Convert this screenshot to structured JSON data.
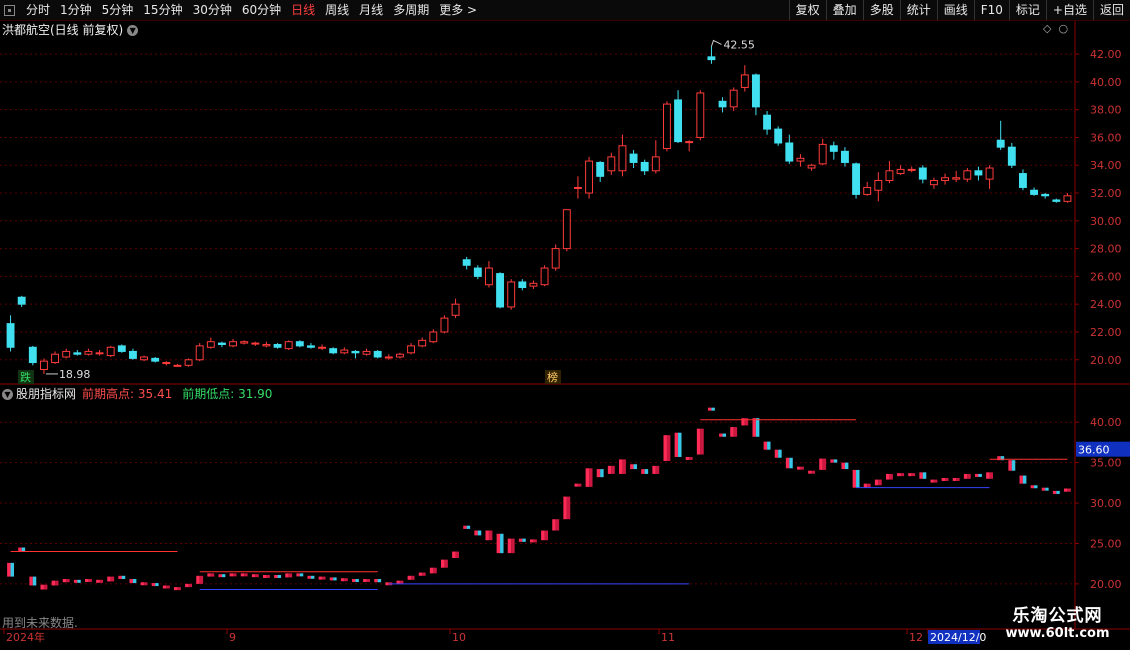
{
  "toolbar": {
    "left": [
      "分时",
      "1分钟",
      "5分钟",
      "15分钟",
      "30分钟",
      "60分钟",
      "日线",
      "周线",
      "月线",
      "多周期",
      "更多 >"
    ],
    "active_index": 6,
    "right": [
      "复权",
      "叠加",
      "多股",
      "统计",
      "画线",
      "F10",
      "标记",
      "+自选",
      "返回"
    ]
  },
  "stock_title": "洪都航空(日线 前复权)",
  "indicator": {
    "name": "股朋指标网",
    "high_label": "前期高点: 35.41",
    "low_label": "前期低点: 31.90",
    "current_value": "36.60"
  },
  "price_axis": [
    "42.00",
    "40.00",
    "38.00",
    "36.00",
    "34.00",
    "32.00",
    "30.00",
    "28.00",
    "26.00",
    "24.00",
    "22.00",
    "20.00"
  ],
  "ind_axis": [
    "40.00",
    "35.00",
    "30.00",
    "25.00",
    "20.00"
  ],
  "annotations": {
    "high": "42.55",
    "low": "18.98",
    "tag_die": "跌",
    "tag_bang": "榜"
  },
  "date_labels": [
    "2024年",
    "9",
    "10",
    "11",
    "12",
    "2024/12/0"
  ],
  "footer_note": "用到未来数据.",
  "watermark": {
    "name": "乐淘公式网",
    "url": "www.60lt.com"
  },
  "colors": {
    "up": "#ff3b3b",
    "down": "#40e0f0",
    "grid": "#5a0000",
    "axis_text": "#cc3333"
  },
  "chart_data": {
    "type": "candlestick",
    "candles": [
      [
        22.6,
        20.9,
        23.2,
        20.6
      ],
      [
        24.5,
        24.0,
        24.6,
        23.8
      ],
      [
        20.9,
        19.8,
        21.0,
        19.6
      ],
      [
        19.3,
        19.9,
        20.1,
        18.98
      ],
      [
        19.8,
        20.4,
        20.6,
        19.7
      ],
      [
        20.2,
        20.6,
        20.8,
        20.1
      ],
      [
        20.5,
        20.4,
        20.7,
        20.3
      ],
      [
        20.4,
        20.6,
        20.8,
        20.3
      ],
      [
        20.5,
        20.5,
        20.7,
        20.3
      ],
      [
        20.3,
        20.9,
        21.0,
        20.2
      ],
      [
        21.0,
        20.6,
        21.1,
        20.5
      ],
      [
        20.6,
        20.1,
        20.8,
        20.0
      ],
      [
        20.0,
        20.2,
        20.3,
        19.9
      ],
      [
        20.1,
        19.9,
        20.2,
        19.8
      ],
      [
        19.8,
        19.8,
        19.9,
        19.6
      ],
      [
        19.6,
        19.6,
        19.7,
        19.5
      ],
      [
        19.6,
        20.0,
        20.1,
        19.5
      ],
      [
        20.0,
        21.0,
        21.2,
        19.9
      ],
      [
        20.9,
        21.3,
        21.6,
        20.8
      ],
      [
        21.2,
        21.1,
        21.3,
        20.9
      ],
      [
        21.0,
        21.3,
        21.5,
        20.9
      ],
      [
        21.2,
        21.3,
        21.4,
        21.1
      ],
      [
        21.2,
        21.2,
        21.3,
        21.0
      ],
      [
        21.0,
        21.1,
        21.3,
        20.9
      ],
      [
        21.1,
        20.9,
        21.2,
        20.8
      ],
      [
        20.8,
        21.3,
        21.4,
        20.7
      ],
      [
        21.3,
        21.0,
        21.4,
        20.9
      ],
      [
        21.0,
        20.9,
        21.2,
        20.8
      ],
      [
        20.9,
        20.9,
        21.1,
        20.7
      ],
      [
        20.8,
        20.5,
        20.9,
        20.4
      ],
      [
        20.5,
        20.7,
        20.9,
        20.4
      ],
      [
        20.6,
        20.5,
        20.7,
        20.1
      ],
      [
        20.4,
        20.6,
        20.8,
        20.3
      ],
      [
        20.6,
        20.2,
        20.7,
        20.1
      ],
      [
        20.2,
        20.2,
        20.4,
        20.0
      ],
      [
        20.2,
        20.4,
        20.5,
        20.1
      ],
      [
        20.5,
        21.0,
        21.2,
        20.4
      ],
      [
        21.0,
        21.4,
        21.6,
        20.9
      ],
      [
        21.3,
        22.0,
        22.2,
        21.2
      ],
      [
        22.0,
        23.0,
        23.2,
        21.9
      ],
      [
        23.2,
        24.0,
        24.4,
        23.0
      ],
      [
        27.2,
        26.8,
        27.4,
        26.5
      ],
      [
        26.6,
        26.0,
        26.8,
        25.8
      ],
      [
        25.4,
        26.6,
        27.1,
        25.2
      ],
      [
        26.2,
        23.8,
        26.3,
        23.7
      ],
      [
        23.8,
        25.6,
        25.8,
        23.6
      ],
      [
        25.6,
        25.2,
        25.8,
        25.0
      ],
      [
        25.3,
        25.5,
        25.7,
        25.1
      ],
      [
        25.4,
        26.6,
        26.8,
        25.3
      ],
      [
        26.6,
        28.0,
        28.3,
        26.4
      ],
      [
        28.0,
        30.8,
        30.8,
        27.8
      ],
      [
        32.4,
        32.4,
        33.2,
        31.6
      ],
      [
        32.0,
        34.3,
        34.6,
        31.6
      ],
      [
        34.2,
        33.2,
        34.3,
        32.8
      ],
      [
        33.6,
        34.6,
        34.9,
        33.3
      ],
      [
        33.6,
        35.4,
        36.2,
        33.2
      ],
      [
        34.8,
        34.2,
        35.1,
        33.8
      ],
      [
        34.2,
        33.6,
        34.4,
        33.3
      ],
      [
        33.6,
        34.6,
        35.8,
        33.4
      ],
      [
        35.2,
        38.4,
        38.6,
        35.0
      ],
      [
        38.7,
        35.7,
        39.4,
        35.6
      ],
      [
        35.7,
        35.7,
        35.8,
        35.0
      ],
      [
        36.0,
        39.2,
        39.4,
        35.8
      ],
      [
        41.8,
        41.6,
        42.55,
        41.3
      ],
      [
        38.6,
        38.2,
        38.9,
        37.8
      ],
      [
        38.2,
        39.4,
        39.6,
        37.9
      ],
      [
        39.6,
        40.5,
        41.2,
        39.3
      ],
      [
        40.5,
        38.2,
        40.6,
        37.6
      ],
      [
        37.6,
        36.6,
        37.9,
        36.2
      ],
      [
        36.6,
        35.6,
        36.8,
        35.4
      ],
      [
        35.6,
        34.3,
        36.2,
        34.1
      ],
      [
        34.3,
        34.5,
        34.8,
        33.9
      ],
      [
        33.8,
        34.0,
        34.1,
        33.6
      ],
      [
        34.1,
        35.5,
        35.9,
        34.0
      ],
      [
        35.4,
        35.0,
        35.7,
        34.4
      ],
      [
        35.0,
        34.2,
        35.3,
        33.9
      ],
      [
        34.1,
        31.9,
        34.2,
        31.6
      ],
      [
        31.9,
        32.4,
        32.8,
        31.8
      ],
      [
        32.2,
        32.9,
        33.5,
        31.4
      ],
      [
        32.9,
        33.6,
        34.3,
        32.7
      ],
      [
        33.4,
        33.7,
        34.0,
        33.3
      ],
      [
        33.7,
        33.7,
        33.9,
        33.5
      ],
      [
        33.8,
        33.0,
        34.0,
        32.7
      ],
      [
        32.6,
        32.9,
        33.1,
        32.3
      ],
      [
        32.9,
        33.1,
        33.4,
        32.6
      ],
      [
        33.0,
        33.1,
        33.6,
        32.8
      ],
      [
        33.0,
        33.6,
        33.8,
        32.8
      ],
      [
        33.6,
        33.3,
        33.9,
        32.9
      ],
      [
        33.0,
        33.8,
        34.0,
        32.3
      ],
      [
        35.8,
        35.3,
        37.2,
        35.1
      ],
      [
        35.3,
        34.0,
        35.6,
        33.8
      ],
      [
        33.4,
        32.4,
        33.7,
        32.2
      ],
      [
        32.2,
        31.9,
        32.4,
        31.8
      ],
      [
        31.9,
        31.8,
        32.0,
        31.6
      ],
      [
        31.5,
        31.4,
        31.6,
        31.3
      ],
      [
        31.4,
        31.8,
        32.0,
        31.3
      ]
    ],
    "price_range": [
      18.4,
      43.3
    ],
    "indicator_range": [
      18.5,
      42.5
    ],
    "high_line": 35.41,
    "low_line": 31.9
  }
}
